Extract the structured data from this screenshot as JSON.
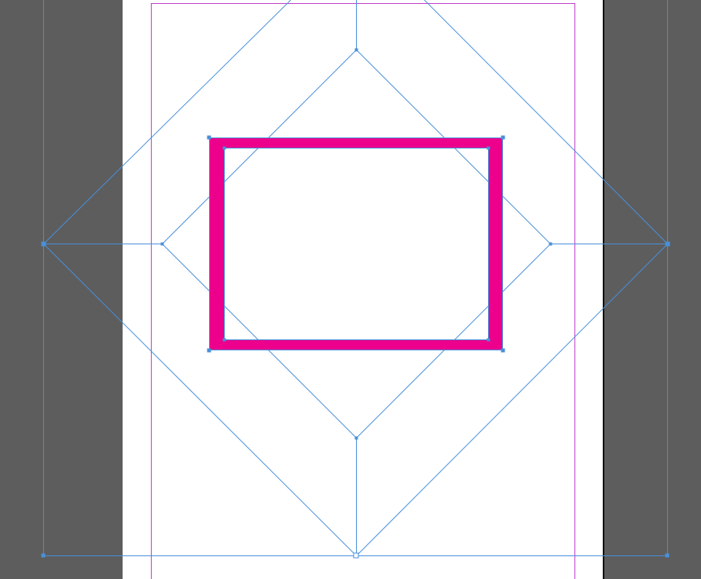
{
  "colors": {
    "pasteboard": "#5d5d5d",
    "page": "#ffffff",
    "page_shadow": "#111111",
    "margin_guide": "#c040c8",
    "selection": "#4a90d9",
    "frame_stroke": "#ec008c",
    "handle_fill": "#ffffff"
  },
  "icons": {
    "anchor_point": "square-anchor-icon",
    "reference_point": "hollow-square-icon"
  }
}
